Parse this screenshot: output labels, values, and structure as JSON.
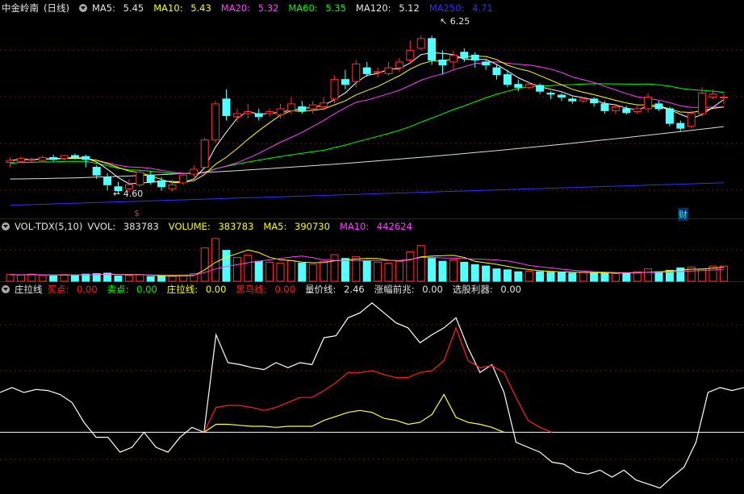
{
  "price_header": {
    "stock_name": "中金岭南",
    "period": "(日线)",
    "ma5_label": "MA5:",
    "ma5": "5.45",
    "ma10_label": "MA10:",
    "ma10": "5.43",
    "ma20_label": "MA20:",
    "ma20": "5.32",
    "ma60_label": "MA60:",
    "ma60": "5.35",
    "ma120_label": "MA120:",
    "ma120": "5.12",
    "ma250_label": "MA250:",
    "ma250": "4.71"
  },
  "vol_header": {
    "name": "VOL-TDX(5,10)",
    "vvol_label": "VVOL:",
    "vvol": "383783",
    "volume_label": "VOLUME:",
    "volume": "383783",
    "ma5_label": "MA5:",
    "ma5": "390730",
    "ma10_label": "MA10:",
    "ma10": "442624"
  },
  "ind_header": {
    "name": "庄拉线",
    "buy_label": "买点:",
    "buy": "0.00",
    "sell_label": "卖点:",
    "sell": "0.00",
    "zlx_label": "庄拉线:",
    "zlx": "0.00",
    "hmx_label": "黑马线:",
    "hmx": "0.00",
    "ljx_label": "量价线:",
    "ljx": "2.46",
    "zfqz_label": "涨幅前兆:",
    "zfqz": "0.00",
    "xglq_label": "选股利器:",
    "xglq": "0.00"
  },
  "annotations": {
    "high_label": "6.25",
    "low_label": "4.60",
    "marker_s": "$",
    "marker_cai": "财"
  },
  "colors": {
    "up": "#ff3030",
    "down": "#54ffff",
    "ma5": "#ffffff",
    "ma10": "#ffff00",
    "ma20": "#ff40ff",
    "ma60": "#00ff00",
    "ma120": "#dddddd",
    "ma250": "#3030ff"
  },
  "chart_data": [
    {
      "type": "candlestick",
      "title": "中金岭南 (日线)",
      "price_range": [
        4.45,
        6.45
      ],
      "candles": [
        [
          4.95,
          4.97,
          4.9,
          5.0
        ],
        [
          4.96,
          4.99,
          4.94,
          5.01
        ],
        [
          4.97,
          4.98,
          4.95,
          5.0
        ],
        [
          4.97,
          5.0,
          4.95,
          5.02
        ],
        [
          5.0,
          4.98,
          4.96,
          5.03
        ],
        [
          4.99,
          5.02,
          4.97,
          5.03
        ],
        [
          5.02,
          5.0,
          4.98,
          5.04
        ],
        [
          5.01,
          4.98,
          4.9,
          5.03
        ],
        [
          4.9,
          4.82,
          4.78,
          4.92
        ],
        [
          4.8,
          4.72,
          4.66,
          4.84
        ],
        [
          4.7,
          4.66,
          4.63,
          4.75
        ],
        [
          4.68,
          4.72,
          4.64,
          4.78
        ],
        [
          4.72,
          4.85,
          4.7,
          4.88
        ],
        [
          4.82,
          4.75,
          4.72,
          4.86
        ],
        [
          4.76,
          4.7,
          4.66,
          4.8
        ],
        [
          4.68,
          4.72,
          4.65,
          4.77
        ],
        [
          4.74,
          4.82,
          4.72,
          4.85
        ],
        [
          4.83,
          4.88,
          4.8,
          4.92
        ],
        [
          4.9,
          5.18,
          4.88,
          5.2
        ],
        [
          5.18,
          5.55,
          5.15,
          5.58
        ],
        [
          5.6,
          5.43,
          5.38,
          5.7
        ],
        [
          5.42,
          5.45,
          5.36,
          5.5
        ],
        [
          5.45,
          5.47,
          5.4,
          5.55
        ],
        [
          5.45,
          5.42,
          5.38,
          5.5
        ],
        [
          5.45,
          5.47,
          5.42,
          5.5
        ],
        [
          5.44,
          5.5,
          5.4,
          5.55
        ],
        [
          5.48,
          5.55,
          5.45,
          5.62
        ],
        [
          5.52,
          5.48,
          5.45,
          5.58
        ],
        [
          5.5,
          5.54,
          5.45,
          5.58
        ],
        [
          5.52,
          5.56,
          5.48,
          5.62
        ],
        [
          5.6,
          5.8,
          5.56,
          5.84
        ],
        [
          5.8,
          5.75,
          5.7,
          5.9
        ],
        [
          5.78,
          5.96,
          5.72,
          6.0
        ],
        [
          5.92,
          5.86,
          5.83,
          5.98
        ],
        [
          5.88,
          5.88,
          5.82,
          5.92
        ],
        [
          5.86,
          5.92,
          5.84,
          5.98
        ],
        [
          5.92,
          5.98,
          5.88,
          6.02
        ],
        [
          6.0,
          6.1,
          5.96,
          6.2
        ],
        [
          6.12,
          6.22,
          6.1,
          6.25
        ],
        [
          6.22,
          6.0,
          5.95,
          6.25
        ],
        [
          6.0,
          5.95,
          5.85,
          6.1
        ],
        [
          5.98,
          6.05,
          5.9,
          6.1
        ],
        [
          6.08,
          6.02,
          5.98,
          6.12
        ],
        [
          6.05,
          6.0,
          5.92,
          6.08
        ],
        [
          5.98,
          5.95,
          5.9,
          6.0
        ],
        [
          5.92,
          5.85,
          5.8,
          5.95
        ],
        [
          5.85,
          5.75,
          5.72,
          5.9
        ],
        [
          5.75,
          5.72,
          5.68,
          5.8
        ],
        [
          5.72,
          5.75,
          5.7,
          5.78
        ],
        [
          5.74,
          5.68,
          5.65,
          5.76
        ],
        [
          5.66,
          5.65,
          5.6,
          5.68
        ],
        [
          5.64,
          5.62,
          5.58,
          5.66
        ],
        [
          5.6,
          5.58,
          5.55,
          5.62
        ],
        [
          5.58,
          5.6,
          5.56,
          5.62
        ],
        [
          5.6,
          5.56,
          5.52,
          5.62
        ],
        [
          5.55,
          5.48,
          5.45,
          5.58
        ],
        [
          5.48,
          5.52,
          5.45,
          5.55
        ],
        [
          5.5,
          5.46,
          5.44,
          5.53
        ],
        [
          5.47,
          5.5,
          5.45,
          5.53
        ],
        [
          5.5,
          5.62,
          5.46,
          5.66
        ],
        [
          5.55,
          5.5,
          5.48,
          5.58
        ],
        [
          5.5,
          5.35,
          5.32,
          5.52
        ],
        [
          5.35,
          5.3,
          5.27,
          5.38
        ],
        [
          5.32,
          5.45,
          5.3,
          5.48
        ],
        [
          5.45,
          5.66,
          5.42,
          5.72
        ],
        [
          5.62,
          5.65,
          5.6,
          5.7
        ],
        [
          5.62,
          5.62,
          5.55,
          5.65
        ]
      ]
    },
    {
      "type": "bar",
      "title": "VOL-TDX(5,10)",
      "values": [
        140,
        130,
        150,
        120,
        110,
        140,
        130,
        150,
        160,
        170,
        110,
        120,
        140,
        100,
        110,
        105,
        130,
        160,
        700,
        900,
        650,
        500,
        550,
        420,
        400,
        380,
        430,
        380,
        360,
        420,
        560,
        480,
        520,
        430,
        400,
        380,
        420,
        620,
        750,
        480,
        420,
        450,
        400,
        350,
        320,
        260,
        240,
        200,
        210,
        200,
        190,
        180,
        170,
        190,
        180,
        170,
        160,
        170,
        200,
        260,
        200,
        230,
        280,
        300,
        260,
        320,
        320
      ],
      "max_value": 1000
    },
    {
      "type": "line",
      "title": "庄拉线",
      "series": [
        {
          "name": "white",
          "values": [
            0.4,
            0.45,
            0.4,
            0.43,
            0.42,
            0.38,
            0.3,
            0.1,
            -0.05,
            -0.05,
            -0.2,
            -0.15,
            0.0,
            -0.15,
            -0.2,
            -0.05,
            0.05,
            0.0,
            0.98,
            0.7,
            0.68,
            0.65,
            0.63,
            0.7,
            0.65,
            0.7,
            0.68,
            0.95,
            0.97,
            1.15,
            1.2,
            1.3,
            1.2,
            1.1,
            1.05,
            0.9,
            0.98,
            1.05,
            1.15,
            0.85,
            0.6,
            0.68,
            0.4,
            -0.1,
            -0.15,
            -0.2,
            -0.3,
            -0.32,
            -0.4,
            -0.42,
            -0.38,
            -0.45,
            -0.38,
            -0.48,
            -0.52,
            -0.56,
            -0.45,
            -0.35,
            -0.1,
            0.4,
            0.45,
            0.42,
            0.45
          ]
        },
        {
          "name": "red",
          "values": [
            null,
            null,
            null,
            null,
            null,
            null,
            null,
            null,
            null,
            null,
            null,
            null,
            null,
            null,
            null,
            null,
            null,
            0.0,
            0.25,
            0.27,
            0.27,
            0.25,
            0.22,
            0.25,
            0.3,
            0.35,
            0.35,
            0.42,
            0.5,
            0.6,
            0.6,
            0.62,
            0.58,
            0.55,
            0.55,
            0.6,
            0.62,
            0.72,
            1.05,
            0.72,
            0.65,
            0.67,
            0.6,
            0.35,
            0.12,
            0.05,
            0.0,
            null,
            null,
            null,
            null,
            null,
            null,
            null,
            null,
            null,
            null,
            null,
            null,
            null,
            null,
            null,
            null
          ]
        },
        {
          "name": "yellow",
          "values": [
            null,
            null,
            null,
            null,
            null,
            null,
            null,
            null,
            null,
            null,
            null,
            null,
            null,
            null,
            null,
            null,
            null,
            0.0,
            0.08,
            0.08,
            0.07,
            0.06,
            0.06,
            0.05,
            0.06,
            0.06,
            0.06,
            0.12,
            0.16,
            0.2,
            0.22,
            0.2,
            0.14,
            0.12,
            0.08,
            0.1,
            0.18,
            0.38,
            0.15,
            0.1,
            0.08,
            0.05,
            0.0,
            null,
            null,
            null,
            null,
            null,
            null,
            null,
            null,
            null,
            null,
            null,
            null,
            null,
            null,
            null,
            null,
            null,
            null,
            null,
            null
          ]
        }
      ],
      "range": [
        -0.62,
        1.38
      ]
    }
  ]
}
